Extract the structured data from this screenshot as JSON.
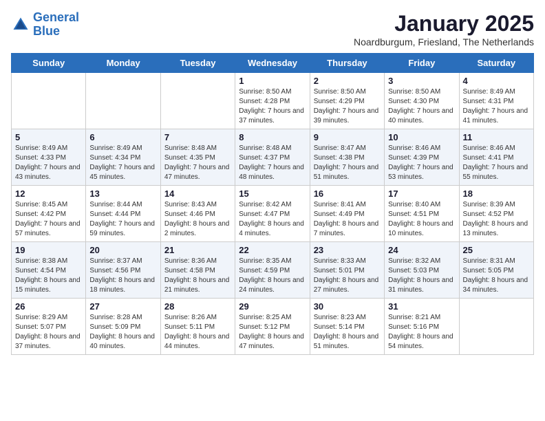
{
  "logo": {
    "line1": "General",
    "line2": "Blue"
  },
  "title": "January 2025",
  "subtitle": "Noardburgum, Friesland, The Netherlands",
  "days": [
    "Sunday",
    "Monday",
    "Tuesday",
    "Wednesday",
    "Thursday",
    "Friday",
    "Saturday"
  ],
  "weeks": [
    [
      {
        "date": "",
        "sunrise": "",
        "sunset": "",
        "daylight": ""
      },
      {
        "date": "",
        "sunrise": "",
        "sunset": "",
        "daylight": ""
      },
      {
        "date": "",
        "sunrise": "",
        "sunset": "",
        "daylight": ""
      },
      {
        "date": "1",
        "sunrise": "8:50 AM",
        "sunset": "4:28 PM",
        "daylight": "7 hours and 37 minutes."
      },
      {
        "date": "2",
        "sunrise": "8:50 AM",
        "sunset": "4:29 PM",
        "daylight": "7 hours and 39 minutes."
      },
      {
        "date": "3",
        "sunrise": "8:50 AM",
        "sunset": "4:30 PM",
        "daylight": "7 hours and 40 minutes."
      },
      {
        "date": "4",
        "sunrise": "8:49 AM",
        "sunset": "4:31 PM",
        "daylight": "7 hours and 41 minutes."
      }
    ],
    [
      {
        "date": "5",
        "sunrise": "8:49 AM",
        "sunset": "4:33 PM",
        "daylight": "7 hours and 43 minutes."
      },
      {
        "date": "6",
        "sunrise": "8:49 AM",
        "sunset": "4:34 PM",
        "daylight": "7 hours and 45 minutes."
      },
      {
        "date": "7",
        "sunrise": "8:48 AM",
        "sunset": "4:35 PM",
        "daylight": "7 hours and 47 minutes."
      },
      {
        "date": "8",
        "sunrise": "8:48 AM",
        "sunset": "4:37 PM",
        "daylight": "7 hours and 48 minutes."
      },
      {
        "date": "9",
        "sunrise": "8:47 AM",
        "sunset": "4:38 PM",
        "daylight": "7 hours and 51 minutes."
      },
      {
        "date": "10",
        "sunrise": "8:46 AM",
        "sunset": "4:39 PM",
        "daylight": "7 hours and 53 minutes."
      },
      {
        "date": "11",
        "sunrise": "8:46 AM",
        "sunset": "4:41 PM",
        "daylight": "7 hours and 55 minutes."
      }
    ],
    [
      {
        "date": "12",
        "sunrise": "8:45 AM",
        "sunset": "4:42 PM",
        "daylight": "7 hours and 57 minutes."
      },
      {
        "date": "13",
        "sunrise": "8:44 AM",
        "sunset": "4:44 PM",
        "daylight": "7 hours and 59 minutes."
      },
      {
        "date": "14",
        "sunrise": "8:43 AM",
        "sunset": "4:46 PM",
        "daylight": "8 hours and 2 minutes."
      },
      {
        "date": "15",
        "sunrise": "8:42 AM",
        "sunset": "4:47 PM",
        "daylight": "8 hours and 4 minutes."
      },
      {
        "date": "16",
        "sunrise": "8:41 AM",
        "sunset": "4:49 PM",
        "daylight": "8 hours and 7 minutes."
      },
      {
        "date": "17",
        "sunrise": "8:40 AM",
        "sunset": "4:51 PM",
        "daylight": "8 hours and 10 minutes."
      },
      {
        "date": "18",
        "sunrise": "8:39 AM",
        "sunset": "4:52 PM",
        "daylight": "8 hours and 13 minutes."
      }
    ],
    [
      {
        "date": "19",
        "sunrise": "8:38 AM",
        "sunset": "4:54 PM",
        "daylight": "8 hours and 15 minutes."
      },
      {
        "date": "20",
        "sunrise": "8:37 AM",
        "sunset": "4:56 PM",
        "daylight": "8 hours and 18 minutes."
      },
      {
        "date": "21",
        "sunrise": "8:36 AM",
        "sunset": "4:58 PM",
        "daylight": "8 hours and 21 minutes."
      },
      {
        "date": "22",
        "sunrise": "8:35 AM",
        "sunset": "4:59 PM",
        "daylight": "8 hours and 24 minutes."
      },
      {
        "date": "23",
        "sunrise": "8:33 AM",
        "sunset": "5:01 PM",
        "daylight": "8 hours and 27 minutes."
      },
      {
        "date": "24",
        "sunrise": "8:32 AM",
        "sunset": "5:03 PM",
        "daylight": "8 hours and 31 minutes."
      },
      {
        "date": "25",
        "sunrise": "8:31 AM",
        "sunset": "5:05 PM",
        "daylight": "8 hours and 34 minutes."
      }
    ],
    [
      {
        "date": "26",
        "sunrise": "8:29 AM",
        "sunset": "5:07 PM",
        "daylight": "8 hours and 37 minutes."
      },
      {
        "date": "27",
        "sunrise": "8:28 AM",
        "sunset": "5:09 PM",
        "daylight": "8 hours and 40 minutes."
      },
      {
        "date": "28",
        "sunrise": "8:26 AM",
        "sunset": "5:11 PM",
        "daylight": "8 hours and 44 minutes."
      },
      {
        "date": "29",
        "sunrise": "8:25 AM",
        "sunset": "5:12 PM",
        "daylight": "8 hours and 47 minutes."
      },
      {
        "date": "30",
        "sunrise": "8:23 AM",
        "sunset": "5:14 PM",
        "daylight": "8 hours and 51 minutes."
      },
      {
        "date": "31",
        "sunrise": "8:21 AM",
        "sunset": "5:16 PM",
        "daylight": "8 hours and 54 minutes."
      },
      {
        "date": "",
        "sunrise": "",
        "sunset": "",
        "daylight": ""
      }
    ]
  ]
}
